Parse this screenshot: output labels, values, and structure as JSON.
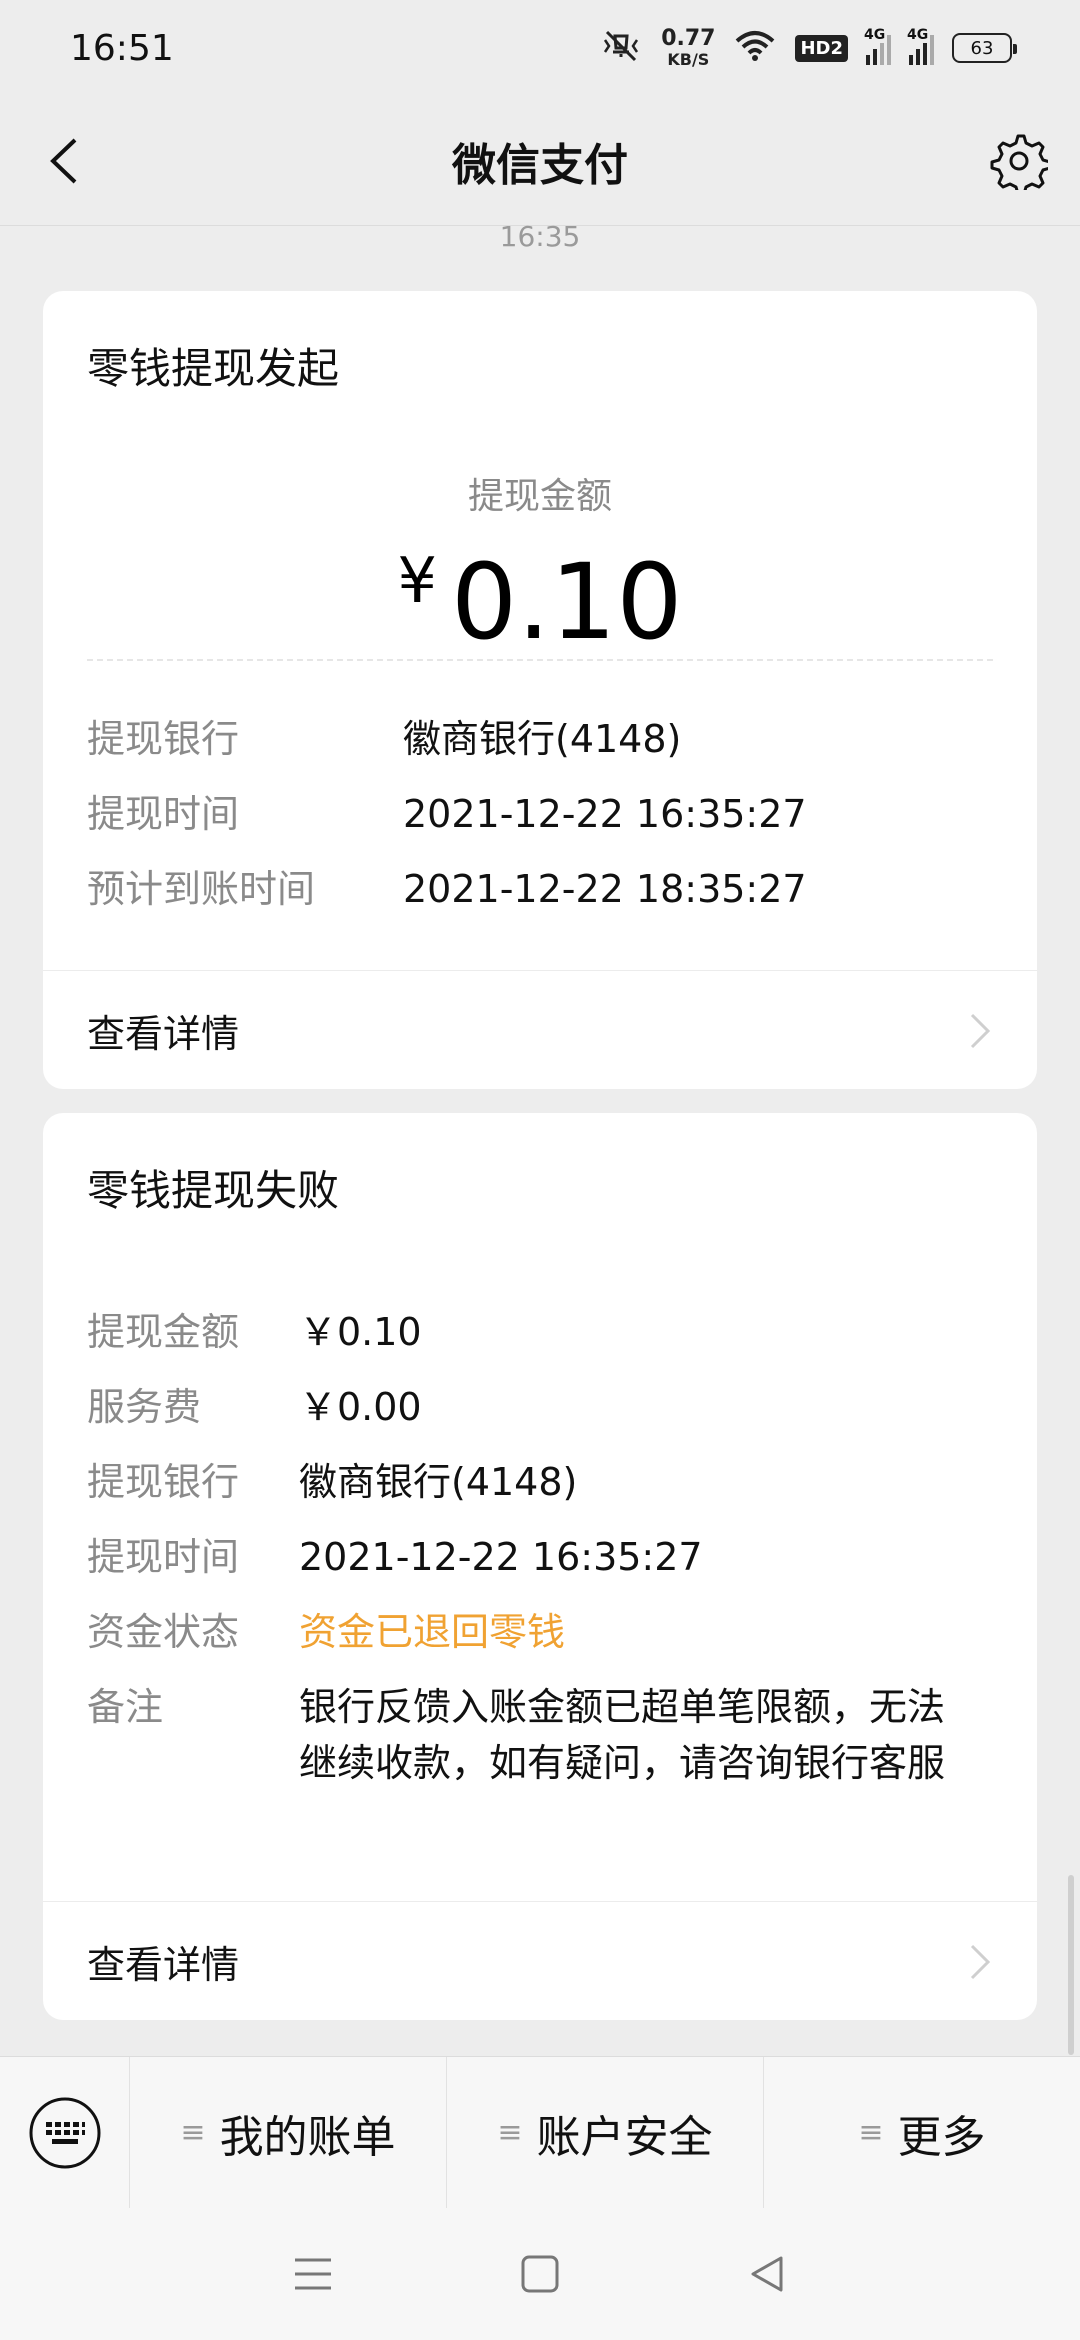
{
  "status_bar": {
    "time": "16:51",
    "net_speed_value": "0.77",
    "net_speed_unit": "KB/S",
    "hd_badge": "HD2",
    "signal_1_label": "4G",
    "signal_2_label": "4G",
    "battery": "63"
  },
  "nav": {
    "title": "微信支付"
  },
  "timestamp": "16:35",
  "card1": {
    "title": "零钱提现发起",
    "amount_label": "提现金额",
    "currency": "¥",
    "amount": "0.10",
    "rows": [
      {
        "key": "提现银行",
        "value": "徽商银行(4148)"
      },
      {
        "key": "提现时间",
        "value": "2021-12-22 16:35:27"
      },
      {
        "key": "预计到账时间",
        "value": "2021-12-22 18:35:27"
      }
    ],
    "detail_link": "查看详情"
  },
  "card2": {
    "title": "零钱提现失败",
    "rows": [
      {
        "key": "提现金额",
        "value": "￥0.10"
      },
      {
        "key": "服务费",
        "value": "￥0.00"
      },
      {
        "key": "提现银行",
        "value": "徽商银行(4148)"
      },
      {
        "key": "提现时间",
        "value": "2021-12-22 16:35:27"
      },
      {
        "key": "资金状态",
        "value": "资金已退回零钱"
      },
      {
        "key": "备注",
        "value": "银行反馈入账金额已超单笔限额，无法继续收款，如有疑问，请咨询银行客服"
      }
    ],
    "detail_link": "查看详情"
  },
  "menu": {
    "items": [
      {
        "label": "我的账单"
      },
      {
        "label": "账户安全"
      },
      {
        "label": "更多"
      }
    ]
  },
  "colors": {
    "warning": "#f0a232",
    "background": "#ededed",
    "card": "#ffffff"
  }
}
